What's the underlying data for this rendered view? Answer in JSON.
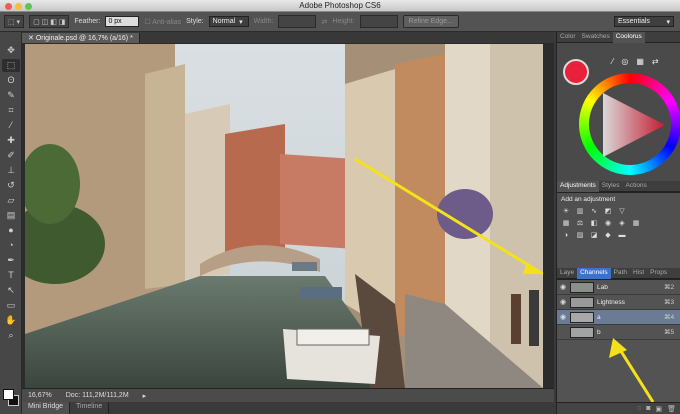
{
  "window": {
    "title": "Adobe Photoshop CS6"
  },
  "options": {
    "feather_label": "Feather:",
    "feather_value": "0 px",
    "antialias_label": "Anti-alias",
    "style_label": "Style:",
    "style_value": "Normal",
    "width_label": "Width:",
    "height_label": "Height:",
    "refine_edge": "Refine Edge...",
    "workspace": "Essentials"
  },
  "document": {
    "tab": "Originale.psd @ 16,7% (a/16) *"
  },
  "status": {
    "zoom": "16,67%",
    "doc_size": "Doc: 111,2M/111,2M"
  },
  "bottom_tabs": [
    "Mini Bridge",
    "Timeline"
  ],
  "color_panel": {
    "tabs": [
      "Color",
      "Swatches",
      "Coolorus"
    ],
    "foreground": "#e8203a"
  },
  "adjustments_panel": {
    "tabs": [
      "Adjustments",
      "Styles",
      "Actions"
    ],
    "title": "Add an adjustment"
  },
  "channels_panel": {
    "tabs": [
      "Laye",
      "Channels",
      "Path",
      "Hist",
      "Props"
    ],
    "rows": [
      {
        "name": "Lab",
        "shortcut": "⌘2"
      },
      {
        "name": "Lightness",
        "shortcut": "⌘3"
      },
      {
        "name": "a",
        "shortcut": "⌘4"
      },
      {
        "name": "b",
        "shortcut": "⌘5"
      }
    ]
  },
  "icons": [
    "move-icon",
    "marquee-icon",
    "lasso-icon",
    "quick-select-icon",
    "crop-icon",
    "eyedropper-icon",
    "healing-icon",
    "brush-icon",
    "stamp-icon",
    "history-brush-icon",
    "eraser-icon",
    "gradient-icon",
    "blur-icon",
    "dodge-icon",
    "pen-icon",
    "type-icon",
    "path-select-icon",
    "shape-icon",
    "hand-icon",
    "zoom-icon"
  ],
  "colors": {
    "accent": "#3b73c8",
    "annotation": "#f5e11a"
  }
}
